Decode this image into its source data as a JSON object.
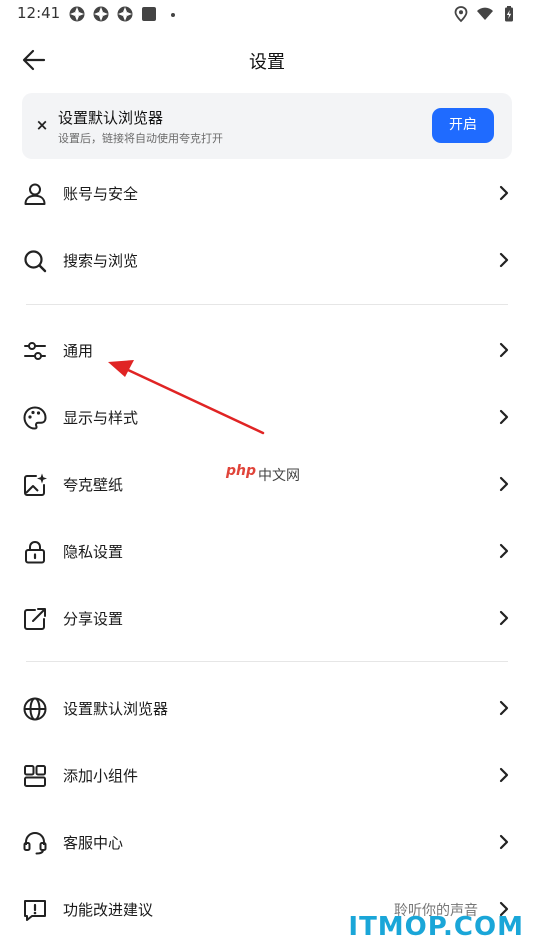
{
  "status_bar": {
    "time": "12:41"
  },
  "header": {
    "title": "设置"
  },
  "banner": {
    "title": "设置默认浏览器",
    "subtitle": "设置后，链接将自动使用夸克打开",
    "button_label": "开启",
    "close_glyph": "×"
  },
  "items": [
    {
      "label": "账号与安全",
      "icon": "person-icon"
    },
    {
      "label": "搜索与浏览",
      "icon": "search-icon"
    },
    {
      "label": "通用",
      "icon": "sliders-icon"
    },
    {
      "label": "显示与样式",
      "icon": "palette-icon"
    },
    {
      "label": "夸克壁纸",
      "icon": "wallpaper-icon"
    },
    {
      "label": "隐私设置",
      "icon": "lock-icon"
    },
    {
      "label": "分享设置",
      "icon": "share-icon"
    },
    {
      "label": "设置默认浏览器",
      "icon": "globe-icon"
    },
    {
      "label": "添加小组件",
      "icon": "widget-icon"
    },
    {
      "label": "客服中心",
      "icon": "headset-icon"
    },
    {
      "label": "功能改进建议",
      "icon": "feedback-icon",
      "extra": "聆听你的声音"
    }
  ],
  "watermarks": {
    "php": "php",
    "php_cn": "中文网",
    "itmop": "ITMOP.COM"
  },
  "colors": {
    "accent": "#1f6bff",
    "annotation_arrow": "#e02424"
  }
}
